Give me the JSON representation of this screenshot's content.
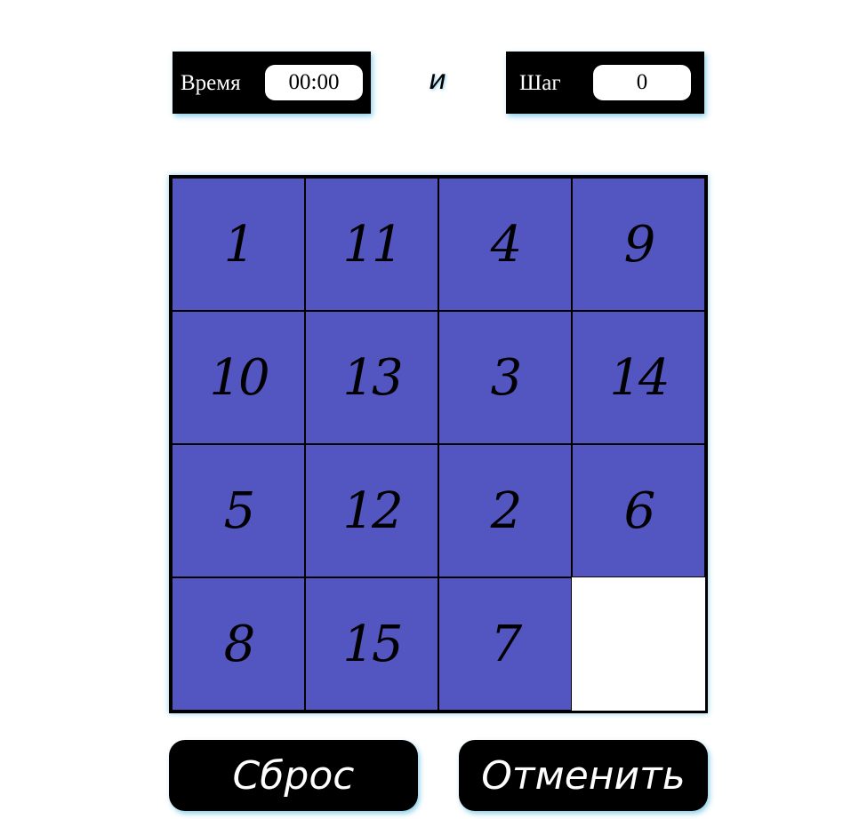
{
  "stats": {
    "time_label": "Время",
    "time_value": "00:00",
    "separator": "и",
    "steps_label": "Шаг",
    "steps_value": "0"
  },
  "board": {
    "size": 4,
    "tiles": [
      "1",
      "11",
      "4",
      "9",
      "10",
      "13",
      "3",
      "14",
      "5",
      "12",
      "2",
      "6",
      "8",
      "15",
      "7",
      ""
    ],
    "tile_color": "#5355c1",
    "empty_color": "#ffffff"
  },
  "buttons": {
    "reset_label": "Сброс",
    "undo_label": "Отменить"
  }
}
